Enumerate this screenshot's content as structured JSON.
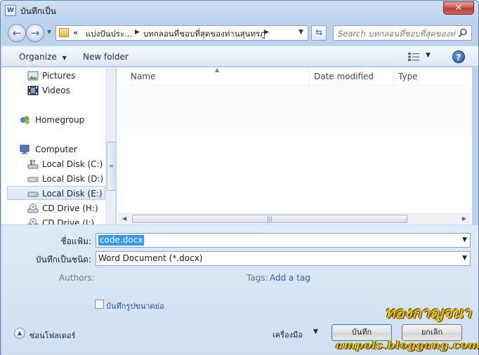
{
  "window": {
    "title": "บันทึกเป็น",
    "icon_letter": "W",
    "close_label": "✕"
  },
  "address": {
    "chevrons": "«",
    "segment1": "แบ่งปันประ...",
    "segment2": "บทกลอนที่ชอบที่สุดของท่านสุนทรภู่",
    "search_placeholder": "Search บทกลอนที่ชอบที่สุดของท่า..."
  },
  "toolbar": {
    "organize_label": "Organize",
    "new_folder_label": "New folder",
    "help_label": "?"
  },
  "nav": {
    "items": [
      {
        "label": "Pictures",
        "icon": "pictures-icon"
      },
      {
        "label": "Videos",
        "icon": "videos-icon"
      },
      {
        "label": "Homegroup",
        "icon": "homegroup-icon"
      },
      {
        "label": "Computer",
        "icon": "computer-icon"
      },
      {
        "label": "Local Disk (C:)",
        "icon": "windows-disk-icon"
      },
      {
        "label": "Local Disk (D:)",
        "icon": "disk-icon"
      },
      {
        "label": "Local Disk (E:)",
        "icon": "disk-icon",
        "selected": true
      },
      {
        "label": "CD Drive (H:)",
        "icon": "cd-drive-icon"
      },
      {
        "label": "CD Drive (I:)",
        "icon": "cd-drive-icon"
      }
    ]
  },
  "file_list": {
    "columns": [
      "Name",
      "Date modified",
      "Type"
    ]
  },
  "form": {
    "filename_label": "ชื่อแฟ้ม:",
    "filename_value": "code.docx",
    "savetype_label": "บันทึกเป็นชนิด:",
    "savetype_value": "Word Document (*.docx)",
    "authors_label": "Authors:",
    "tags_label": "Tags:",
    "tags_link": "Add a tag",
    "thumbnail_label": "บันทึกรูปขนาดย่อ",
    "hide_folders_label": "ซ่อนโฟลเดอร์",
    "tools_label": "เครื่องมือ",
    "save_label": "บันทึก",
    "cancel_label": "ยกเลิก"
  },
  "watermark": {
    "line1": "ทองกาญจนา",
    "line2": "ampols.bloggang.com"
  },
  "colors": {
    "selection": "#3399ff",
    "link": "#2162b4",
    "watermark": "#f2c400"
  }
}
